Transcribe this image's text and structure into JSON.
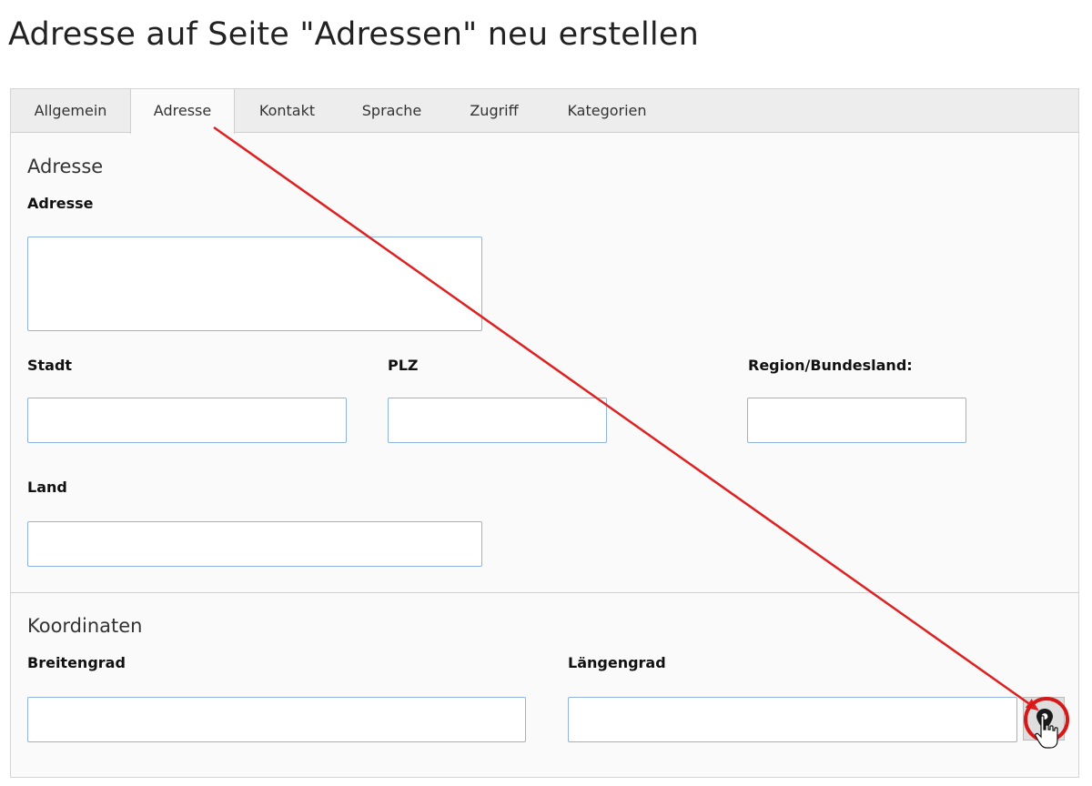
{
  "page": {
    "title": "Adresse auf Seite \"Adressen\" neu erstellen"
  },
  "tabs": [
    {
      "label": "Allgemein",
      "active": false
    },
    {
      "label": "Adresse",
      "active": true
    },
    {
      "label": "Kontakt",
      "active": false
    },
    {
      "label": "Sprache",
      "active": false
    },
    {
      "label": "Zugriff",
      "active": false
    },
    {
      "label": "Kategorien",
      "active": false
    }
  ],
  "address_section": {
    "title": "Adresse",
    "address_label": "Adresse",
    "address_value": "",
    "city_label": "Stadt",
    "city_value": "",
    "zip_label": "PLZ",
    "zip_value": "",
    "region_label": "Region/Bundesland:",
    "region_value": "",
    "country_label": "Land",
    "country_value": ""
  },
  "coordinates_section": {
    "title": "Koordinaten",
    "latitude_label": "Breitengrad",
    "latitude_value": "",
    "longitude_label": "Längengrad",
    "longitude_value": "",
    "map_button_icon": "map-pin-icon"
  },
  "annotation": {
    "arrow_color": "#e02020",
    "highlight_color": "#d81818"
  }
}
